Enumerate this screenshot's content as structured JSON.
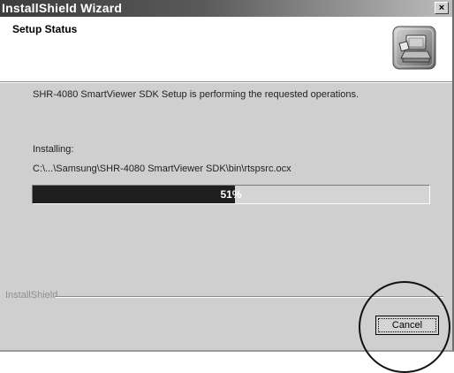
{
  "window": {
    "title": "InstallShield Wizard",
    "close_symbol": "×"
  },
  "header": {
    "title": "Setup Status",
    "icon": "installer-computer-icon"
  },
  "body": {
    "status_text": "SHR-4080 SmartViewer SDK Setup is performing the requested operations.",
    "installing_label": "Installing:",
    "file_path": "C:\\...\\Samsung\\SHR-4080 SmartViewer SDK\\bin\\rtspsrc.ocx"
  },
  "progress": {
    "percent": 51,
    "label": "51%"
  },
  "footer": {
    "brand": "InstallShield",
    "cancel_label": "Cancel"
  },
  "colors": {
    "titlebar_dark": "#3c3c3c",
    "dialog_background": "#cfcfcf",
    "progress_fill": "#1f1f1f"
  }
}
